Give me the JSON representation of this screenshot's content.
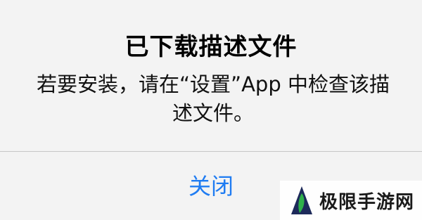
{
  "alert": {
    "title": "已下载描述文件",
    "message": "若要安装，请在“设置”App 中检查该描述文件。",
    "close_label": "关闭"
  },
  "watermark": {
    "text": "极限手游网",
    "logo_icon": "leaf-triangle-logo-icon"
  },
  "colors": {
    "background": "#f3f3f3",
    "accent": "#1f7cf2",
    "divider": "#c7c7c7",
    "logo_green": "#2fb14a",
    "logo_navy": "#1d2a5a"
  }
}
